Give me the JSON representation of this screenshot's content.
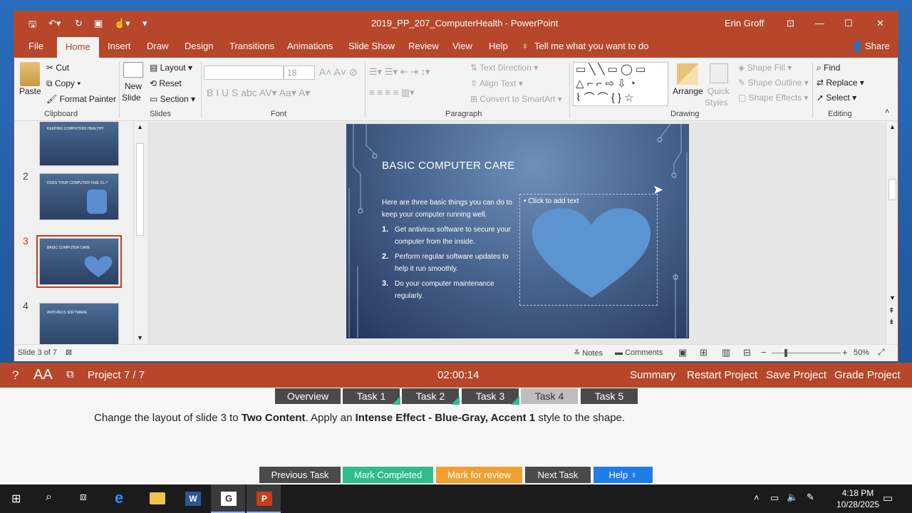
{
  "window": {
    "doc_title": "2019_PP_207_ComputerHealth - PowerPoint",
    "user": "Erin Groff",
    "share": "Share"
  },
  "tabs": [
    "File",
    "Home",
    "Insert",
    "Draw",
    "Design",
    "Transitions",
    "Animations",
    "Slide Show",
    "Review",
    "View",
    "Help"
  ],
  "tell_me": "Tell me what you want to do",
  "ribbon": {
    "clipboard": {
      "paste": "Paste",
      "cut": "Cut",
      "copy": "Copy",
      "format_painter": "Format Painter",
      "label": "Clipboard"
    },
    "slides": {
      "new_slide_1": "New",
      "new_slide_2": "Slide",
      "layout": "Layout",
      "reset": "Reset",
      "section": "Section",
      "label": "Slides"
    },
    "font": {
      "size": "18",
      "label": "Font"
    },
    "paragraph": {
      "text_direction": "Text Direction",
      "align_text": "Align Text",
      "convert": "Convert to SmartArt",
      "label": "Paragraph"
    },
    "drawing": {
      "arrange": "Arrange",
      "quick_styles_1": "Quick",
      "quick_styles_2": "Styles",
      "shape_fill": "Shape Fill",
      "shape_outline": "Shape Outline",
      "shape_effects": "Shape Effects",
      "label": "Drawing"
    },
    "editing": {
      "find": "Find",
      "replace": "Replace",
      "select": "Select",
      "label": "Editing"
    }
  },
  "thumbnails": [
    {
      "num": "",
      "title": "KEEPING COMPUTERS HEALTHY"
    },
    {
      "num": "2",
      "title": "DOES YOUR COMPUTER FEEL ILL?"
    },
    {
      "num": "3",
      "title": "BASIC COMPUTER CARE"
    },
    {
      "num": "4",
      "title": "ANTIVIRUS SOFTWARE"
    }
  ],
  "slide": {
    "title": "BASIC COMPUTER CARE",
    "intro": "Here are three basic things you can do to keep your computer running well.",
    "items": [
      {
        "n": "1.",
        "text": "Get antivirus software to secure your computer from the inside."
      },
      {
        "n": "2.",
        "text": "Perform regular software updates to help it run smoothly."
      },
      {
        "n": "3.",
        "text": "Do your computer maintenance regularly."
      }
    ],
    "placeholder": "Click to add text"
  },
  "status": {
    "slide": "Slide 3 of 7",
    "notes": "Notes",
    "comments": "Comments",
    "zoom": "50%"
  },
  "project": {
    "name": "Project 7 / 7",
    "timer": "02:00:14",
    "summary": "Summary",
    "restart": "Restart Project",
    "save": "Save Project",
    "grade": "Grade Project"
  },
  "tasks": [
    {
      "label": "Overview"
    },
    {
      "label": "Task 1"
    },
    {
      "label": "Task 2"
    },
    {
      "label": "Task 3"
    },
    {
      "label": "Task 4"
    },
    {
      "label": "Task 5"
    }
  ],
  "instruction": {
    "p1": "Change the layout of slide 3 to ",
    "b1": "Two Content",
    "p2": ". Apply an ",
    "b2": "Intense Effect - Blue-Gray, Accent 1",
    "p3": " style to the shape."
  },
  "buttons": {
    "prev": "Previous Task",
    "mark": "Mark Completed",
    "review": "Mark for review",
    "next": "Next Task",
    "help": "Help"
  },
  "clock": {
    "time": "4:18 PM",
    "date": "10/28/2025"
  },
  "colors": {
    "accent": "#b7472a",
    "mark": "#2ebd8c",
    "review": "#f0a030",
    "help": "#1e7ee6"
  }
}
